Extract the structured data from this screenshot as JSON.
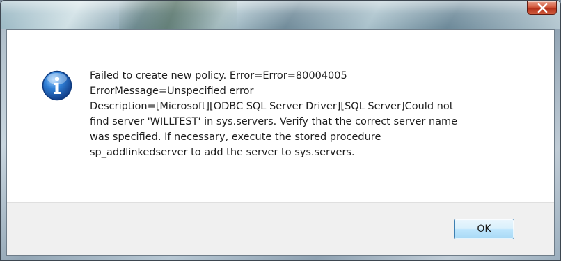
{
  "dialog": {
    "close_glyph": "x",
    "icon": "information-icon",
    "message_lines": [
      "Failed to create new policy. Error=Error=80004005",
      "ErrorMessage=Unspecified error",
      "Description=[Microsoft][ODBC SQL Server Driver][SQL Server]Could not",
      "find server 'WILLTEST' in sys.servers. Verify that the correct server name",
      "was specified. If necessary, execute the stored procedure",
      "sp_addlinkedserver to add the server to sys.servers."
    ],
    "ok_label": "OK"
  },
  "colors": {
    "close_button": "#c9472a",
    "ok_border": "#3c7fb1",
    "info_icon": "#1d5fb4",
    "footer": "#f0f0f0"
  }
}
